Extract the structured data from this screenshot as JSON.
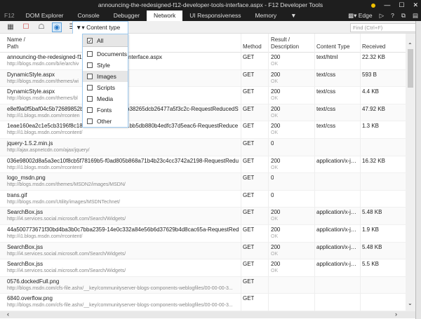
{
  "window": {
    "title": "announcing-the-redesigned-f12-developer-tools-interface.aspx - F12 Developer Tools"
  },
  "tabs": [
    {
      "label": "F12"
    },
    {
      "label": "DOM Explorer"
    },
    {
      "label": "Console"
    },
    {
      "label": "Debugger"
    },
    {
      "label": "Network",
      "active": true
    },
    {
      "label": "UI Responsiveness"
    },
    {
      "label": "Memory"
    }
  ],
  "tabbar_right": {
    "emulation": "Edge",
    "help": "?"
  },
  "toolbar": {
    "content_type_label": "Content type",
    "find_placeholder": "Find (Ctrl+F)"
  },
  "columns": {
    "name": "Name /",
    "path": "Path",
    "method": "Method",
    "result": "Result /",
    "description": "Description",
    "content_type": "Content Type",
    "received": "Received"
  },
  "filter_menu": [
    {
      "label": "All",
      "checked": true
    },
    {
      "label": "Documents",
      "checked": false
    },
    {
      "label": "Style sheets",
      "checked": false
    },
    {
      "label": "Images",
      "checked": false,
      "hover": true
    },
    {
      "label": "Scripts",
      "checked": false
    },
    {
      "label": "Media",
      "checked": false
    },
    {
      "label": "Fonts",
      "checked": false
    },
    {
      "label": "Other",
      "checked": false
    }
  ],
  "requests": [
    {
      "name": "announcing-the-redesigned-f12-developer-tools-interface.aspx",
      "path": "http://blogs.msdn.com/b/ie/archiv",
      "method": "GET",
      "result": "200",
      "desc": "OK",
      "type": "text/html",
      "received": "22.32 KB"
    },
    {
      "name": "DynamicStyle.aspx",
      "path": "http://blogs.msdn.com/themes/wi",
      "method": "GET",
      "result": "200",
      "desc": "OK",
      "type": "text/css",
      "received": "593 B"
    },
    {
      "name": "DynamicStyle.aspx",
      "path": "http://blogs.msdn.com/themes/bl",
      "method": "GET",
      "result": "200",
      "desc": "OK",
      "type": "text/css",
      "received": "4.4 KB"
    },
    {
      "name": "e8ef9a0f5baf04c5b72689852be",
      "path": "http://i1.blogs.msdn.com/rrconten",
      "method": "GET",
      "result": "200",
      "desc": "OK",
      "type": "text/css",
      "received": "47.92 KB",
      "name_tail": "b38265dcb26477a5f3c2c-RequestReducedSt..."
    },
    {
      "name": "1eae160ea2c1e5cb3196f8c1847",
      "path": "http://i1.blogs.msdn.com/rrcontent/",
      "method": "GET",
      "result": "200",
      "desc": "OK",
      "type": "text/css",
      "received": "1.3 KB",
      "name_tail": "1bb5db880b4edfc37d5eac6-RequestReduce..."
    },
    {
      "name": "jquery-1.5.2.min.js",
      "path": "http://ajax.aspnetcdn.com/ajax/jquery/",
      "method": "GET",
      "result": "0",
      "desc": "",
      "type": "",
      "received": ""
    },
    {
      "name": "036e98002d8a5a3ec10f8cb5f78169b5-f0ad805b868a71b4b23c4cc3742a2198-RequestReduced...",
      "path": "http://i1.blogs.msdn.com/rrcontent/",
      "method": "GET",
      "result": "200",
      "desc": "OK",
      "type": "application/x-ja...",
      "received": "16.32 KB"
    },
    {
      "name": "logo_msdn.png",
      "path": "http://blogs.msdn.com/themes/MSDN2/images/MSDN/",
      "method": "GET",
      "result": "0",
      "desc": "",
      "type": "",
      "received": ""
    },
    {
      "name": "trans.gif",
      "path": "http://blogs.msdn.com/Utility/images/MSDNTechnet/",
      "method": "GET",
      "result": "0",
      "desc": "",
      "type": "",
      "received": ""
    },
    {
      "name": "SearchBox.jss",
      "path": "http://i4.services.social.microsoft.com/Search/Widgets/",
      "method": "GET",
      "result": "200",
      "desc": "OK",
      "type": "application/x-ja...",
      "received": "5.48 KB"
    },
    {
      "name": "44a500773671f30bd4ba3b0c7bba2359-14e0c332a84e56b6d37629b4d8cac65a-RequestReduce...",
      "path": "http://i1.blogs.msdn.com/rrcontent/",
      "method": "GET",
      "result": "200",
      "desc": "OK",
      "type": "application/x-ja...",
      "received": "1.9 KB"
    },
    {
      "name": "SearchBox.jss",
      "path": "http://i4.services.social.microsoft.com/Search/Widgets/",
      "method": "GET",
      "result": "200",
      "desc": "OK",
      "type": "application/x-ja...",
      "received": "5.48 KB"
    },
    {
      "name": "SearchBox.jss",
      "path": "http://i4.services.social.microsoft.com/Search/Widgets/",
      "method": "GET",
      "result": "200",
      "desc": "OK",
      "type": "application/x-ja...",
      "received": "5.5 KB"
    },
    {
      "name": "0576.dockedFull.png",
      "path": "http://blogs.msdn.com/cfs-file.ashx/__key/communityserver-blogs-components-weblogfiles/00-00-00-3...",
      "method": "GET",
      "result": "",
      "desc": "",
      "type": "",
      "received": ""
    },
    {
      "name": "6840.overflow.png",
      "path": "http://blogs.msdn.com/cfs-file.ashx/__key/communityserver-blogs-components-weblogfiles/00-00-00-3...",
      "method": "GET",
      "result": "",
      "desc": "",
      "type": "",
      "received": ""
    }
  ]
}
